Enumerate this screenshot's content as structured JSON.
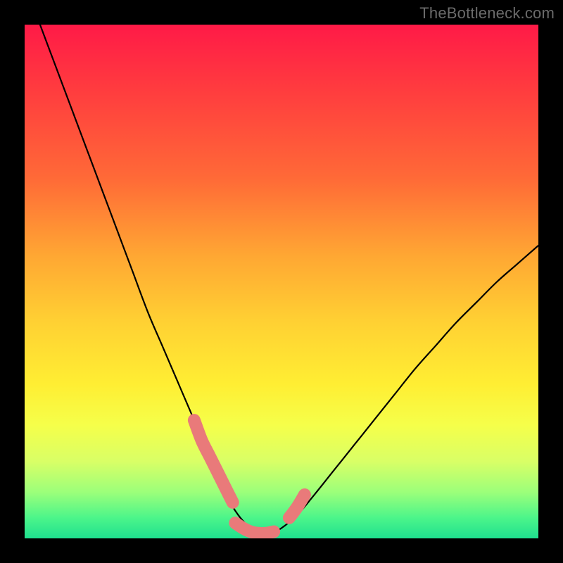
{
  "watermark": "TheBottleneck.com",
  "chart_data": {
    "type": "line",
    "title": "",
    "xlabel": "",
    "ylabel": "",
    "xlim": [
      0,
      100
    ],
    "ylim": [
      0,
      100
    ],
    "series": [
      {
        "name": "bottleneck-curve",
        "x": [
          0,
          3,
          6,
          9,
          12,
          15,
          18,
          21,
          24,
          27,
          30,
          33,
          36,
          38,
          40,
          42,
          44,
          46,
          48,
          50,
          53,
          56,
          60,
          64,
          68,
          72,
          76,
          80,
          84,
          88,
          92,
          96,
          100
        ],
        "values": [
          108,
          100,
          92,
          84,
          76,
          68,
          60,
          52,
          44,
          37,
          30,
          23,
          16,
          11,
          7,
          4,
          2,
          1,
          1,
          2,
          4.5,
          8,
          13,
          18,
          23,
          28,
          33,
          37.5,
          42,
          46,
          50,
          53.5,
          57
        ]
      },
      {
        "name": "marker-track-left",
        "x": [
          33,
          34.5,
          36,
          37.5,
          39,
          40.5
        ],
        "values": [
          23,
          19,
          16,
          13,
          10,
          7
        ]
      },
      {
        "name": "marker-track-bottom",
        "x": [
          41,
          42.5,
          44,
          45.5,
          47,
          48.5
        ],
        "values": [
          3,
          2,
          1.3,
          1,
          1,
          1.3
        ]
      },
      {
        "name": "marker-track-right",
        "x": [
          51.5,
          53,
          54.5
        ],
        "values": [
          4,
          6,
          8.5
        ]
      }
    ],
    "grid": false,
    "legend": false,
    "notes": "Gradient background: red (top, high bottleneck) to green (bottom, low bottleneck). Black curve shows bottleneck vs an implied x-axis parameter. Pink rounded markers highlight the near-minimum region of the curve."
  }
}
